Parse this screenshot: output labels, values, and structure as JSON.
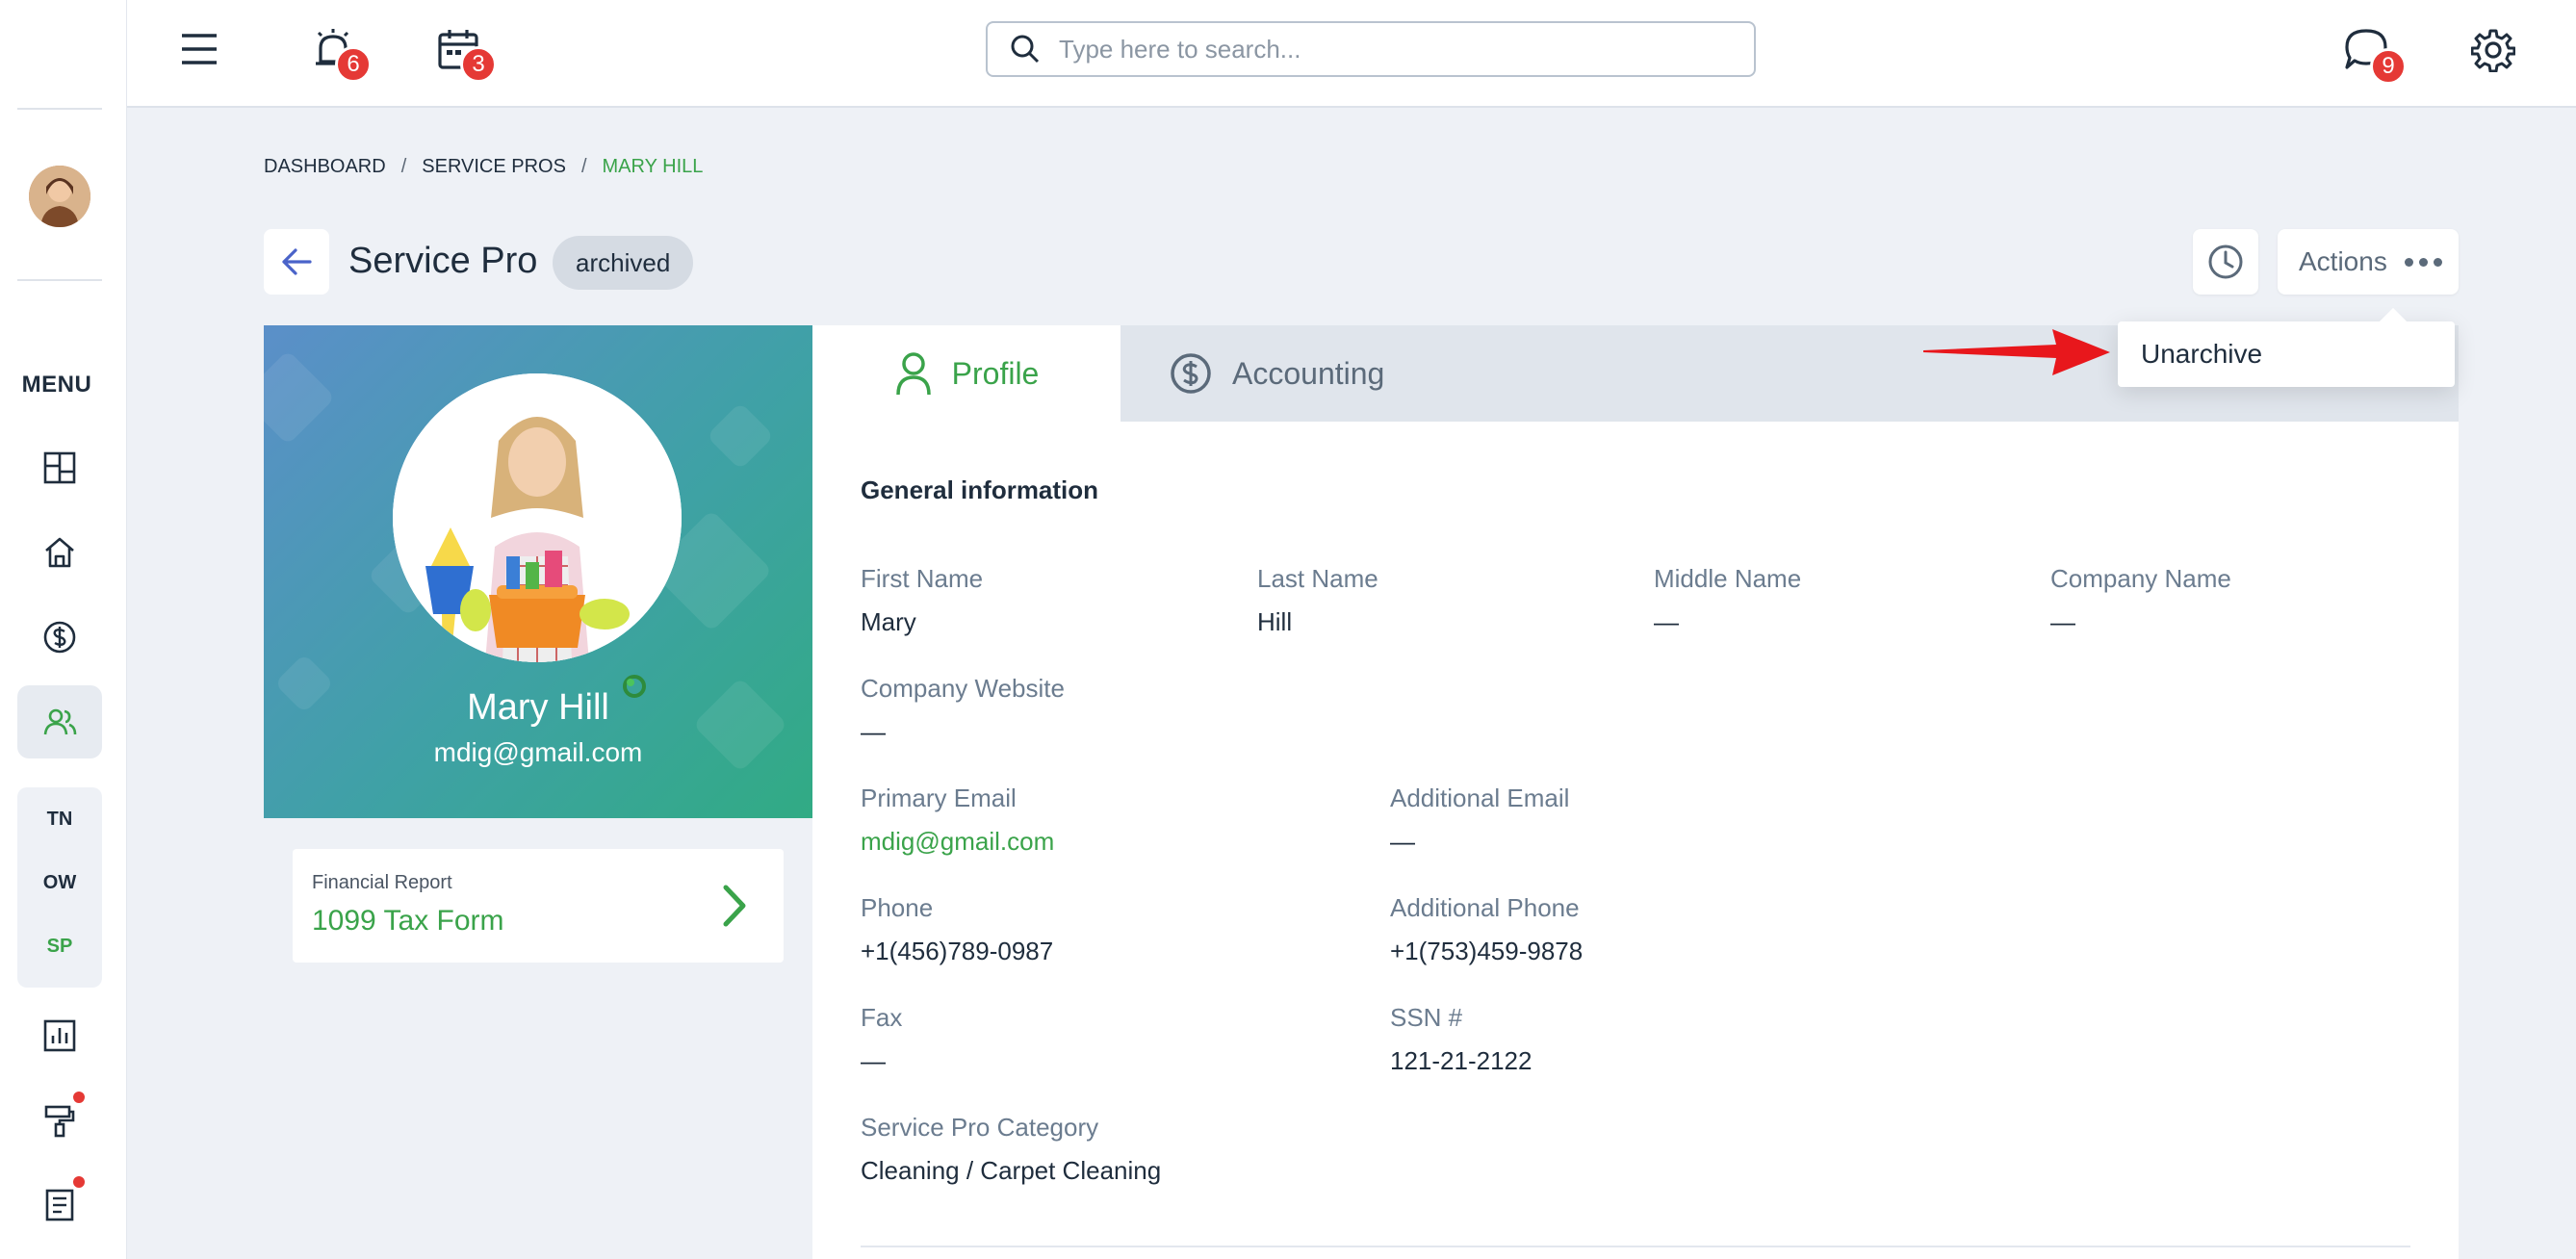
{
  "topbar": {
    "search_placeholder": "Type here to search...",
    "alarm_count": "6",
    "calendar_count": "3",
    "chat_count": "9"
  },
  "sidebar": {
    "menu_label": "MENU",
    "sub_items": [
      "TN",
      "OW",
      "SP"
    ]
  },
  "breadcrumb": {
    "items": [
      "DASHBOARD",
      "SERVICE PROS",
      "MARY HILL"
    ],
    "separator": "/"
  },
  "header": {
    "title": "Service Pro",
    "status": "archived",
    "actions_label": "Actions"
  },
  "dropdown": {
    "unarchive_label": "Unarchive"
  },
  "profile": {
    "name": "Mary Hill",
    "email": "mdig@gmail.com",
    "financial_report_label": "Financial Report",
    "financial_report_value": "1099 Tax Form"
  },
  "tabs": {
    "profile": "Profile",
    "accounting": "Accounting"
  },
  "general": {
    "title": "General information",
    "first_name_label": "First Name",
    "first_name": "Mary",
    "last_name_label": "Last Name",
    "last_name": "Hill",
    "middle_name_label": "Middle Name",
    "middle_name": "—",
    "company_name_label": "Company Name",
    "company_name": "—",
    "company_website_label": "Company Website",
    "company_website": "—",
    "primary_email_label": "Primary Email",
    "primary_email": "mdig@gmail.com",
    "additional_email_label": "Additional Email",
    "additional_email": "—",
    "phone_label": "Phone",
    "phone": "+1(456)789-0987",
    "additional_phone_label": "Additional Phone",
    "additional_phone": "+1(753)459-9878",
    "fax_label": "Fax",
    "fax": "—",
    "ssn_label": "SSN #",
    "ssn": "121-21-2122",
    "category_label": "Service Pro Category",
    "category": "Cleaning / Carpet Cleaning"
  },
  "colors": {
    "accent_green": "#3aa34a",
    "badge_red": "#e53935",
    "text_dark": "#1f2d3d",
    "muted": "#6b7c8f"
  }
}
